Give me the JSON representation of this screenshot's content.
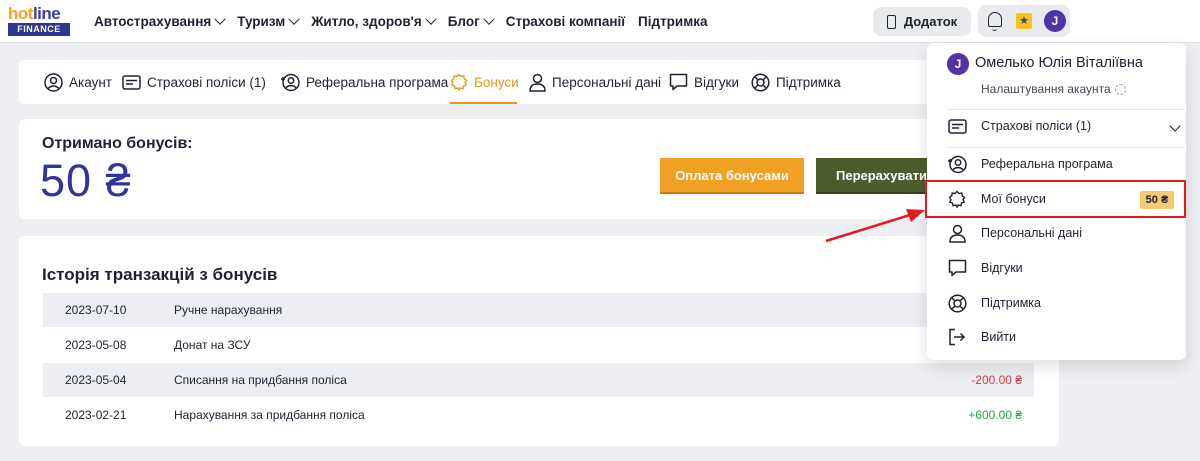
{
  "logo": {
    "line1_hot": "hot",
    "line1_line": "line",
    "line2": "FINANCE"
  },
  "nav": {
    "items": [
      {
        "label": "Автострахування",
        "has_dropdown": true
      },
      {
        "label": "Туризм",
        "has_dropdown": true
      },
      {
        "label": "Житло, здоров'я",
        "has_dropdown": true
      },
      {
        "label": "Блог",
        "has_dropdown": true
      },
      {
        "label": "Страхові компанії",
        "has_dropdown": false
      },
      {
        "label": "Підтримка",
        "has_dropdown": false
      }
    ],
    "app_button": "Додаток",
    "avatar_letter": "J",
    "star_icon": "★"
  },
  "tabs": [
    {
      "label": "Акаунт",
      "icon": "user-circle-icon",
      "active": false
    },
    {
      "label": "Страхові поліси (1)",
      "icon": "card-icon",
      "active": false
    },
    {
      "label": "Реферальна програма",
      "icon": "referral-icon",
      "active": false
    },
    {
      "label": "Бонуси",
      "icon": "badge-icon",
      "active": true
    },
    {
      "label": "Персональні дані",
      "icon": "person-icon",
      "active": false
    },
    {
      "label": "Відгуки",
      "icon": "chat-icon",
      "active": false
    },
    {
      "label": "Підтримка",
      "icon": "lifebuoy-icon",
      "active": false
    }
  ],
  "bonus": {
    "title": "Отримано бонусів:",
    "amount": "50 ₴",
    "pay_button": "Оплата бонусами",
    "transfer_button": "Перерахувати"
  },
  "history": {
    "title": "Історія транзакцій з бонусів",
    "rows": [
      {
        "date": "2023-07-10",
        "description": "Ручне нарахування",
        "amount": ""
      },
      {
        "date": "2023-05-08",
        "description": "Донат на ЗСУ",
        "amount": ""
      },
      {
        "date": "2023-05-04",
        "description": "Списання на придбання поліса",
        "amount": "-200.00 ₴"
      },
      {
        "date": "2023-02-21",
        "description": "Нарахування за придбання поліса",
        "amount": "+600.00 ₴"
      }
    ]
  },
  "dropdown": {
    "avatar_letter": "J",
    "user_name": "Омелько Юлія Віталіївна",
    "settings_label": "Налаштування акаунта",
    "items": [
      {
        "label": "Страхові поліси (1)",
        "icon": "card-icon"
      },
      {
        "label": "Реферальна програма",
        "icon": "referral-icon"
      },
      {
        "label": "Мої бонуси",
        "icon": "badge-icon",
        "badge": "50 ₴"
      },
      {
        "label": "Персональні дані",
        "icon": "person-icon"
      },
      {
        "label": "Відгуки",
        "icon": "chat-icon"
      },
      {
        "label": "Підтримка",
        "icon": "lifebuoy-icon"
      },
      {
        "label": "Вийти",
        "icon": "logout-icon"
      }
    ]
  },
  "colors": {
    "accent_orange": "#f0a023",
    "brand_blue": "#3134a0",
    "military_green": "#4c5d2c",
    "highlight_red": "#e01b24",
    "negative": "#d93a3a",
    "positive": "#2ba24a"
  }
}
